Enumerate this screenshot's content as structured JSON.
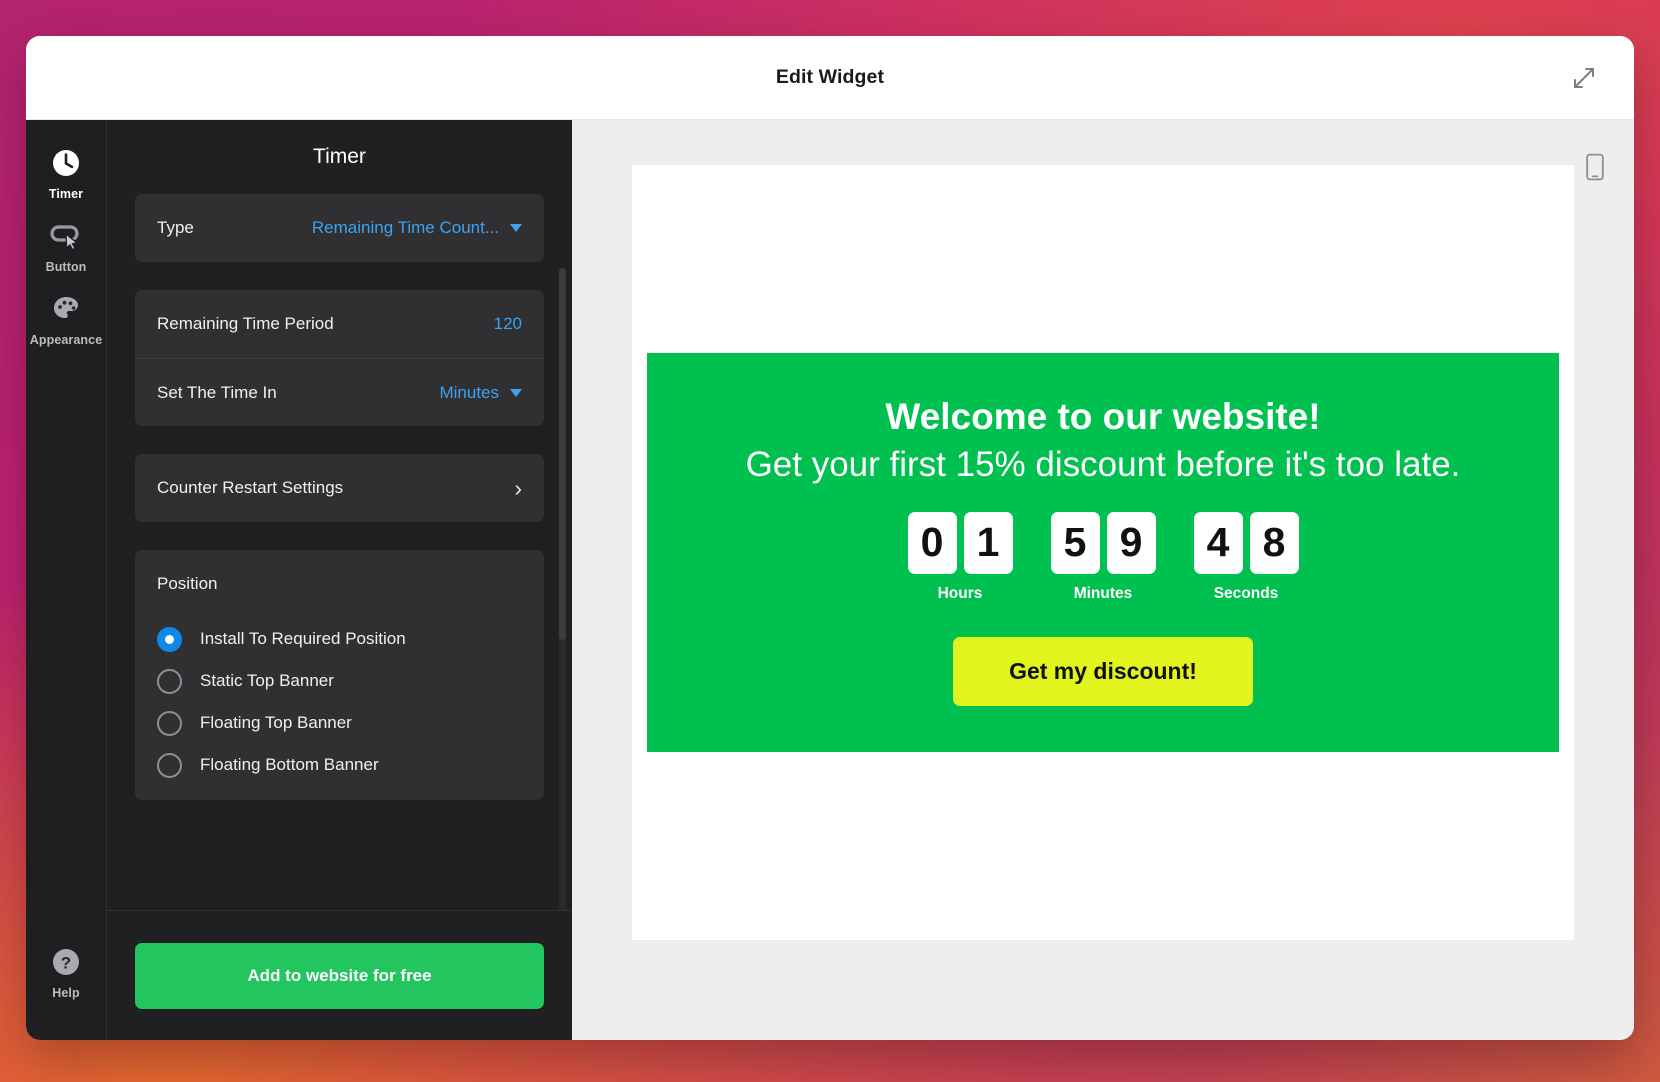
{
  "window": {
    "title": "Edit Widget",
    "expand_icon": "expand-diagonal-icon"
  },
  "rail": {
    "items": [
      {
        "label": "Timer",
        "icon": "clock-icon",
        "active": true
      },
      {
        "label": "Button",
        "icon": "button-cursor-icon",
        "active": false
      },
      {
        "label": "Appearance",
        "icon": "palette-icon",
        "active": false
      }
    ],
    "help": {
      "label": "Help",
      "icon": "question-circle-icon"
    }
  },
  "settings": {
    "title": "Timer",
    "type_row": {
      "label": "Type",
      "value": "Remaining Time Count...",
      "icon": "chevron-down-icon"
    },
    "remaining_time_period": {
      "label": "Remaining Time Period",
      "value": "120"
    },
    "set_time_in": {
      "label": "Set The Time In",
      "value": "Minutes",
      "icon": "chevron-down-icon"
    },
    "counter_restart": {
      "label": "Counter Restart Settings",
      "icon": "chevron-right-icon"
    },
    "position": {
      "title": "Position",
      "options": [
        {
          "label": "Install To Required Position",
          "selected": true
        },
        {
          "label": "Static Top Banner",
          "selected": false
        },
        {
          "label": "Floating Top Banner",
          "selected": false
        },
        {
          "label": "Floating Bottom Banner",
          "selected": false
        }
      ]
    },
    "cta": "Add to website for free"
  },
  "preview": {
    "device_icon": "mobile-phone-icon",
    "widget": {
      "headline": "Welcome to our website!",
      "subheadline": "Get your first 15% discount before it's too late.",
      "countdown": [
        {
          "digits": [
            "0",
            "1"
          ],
          "label": "Hours"
        },
        {
          "digits": [
            "5",
            "9"
          ],
          "label": "Minutes"
        },
        {
          "digits": [
            "4",
            "8"
          ],
          "label": "Seconds"
        }
      ],
      "cta": "Get my discount!"
    }
  },
  "colors": {
    "widget_green": "#00C150",
    "widget_cta_yellow": "#E2F41D",
    "accent_blue": "#3DA2F0",
    "radio_blue": "#0F88E8",
    "install_green": "#23C55E"
  }
}
